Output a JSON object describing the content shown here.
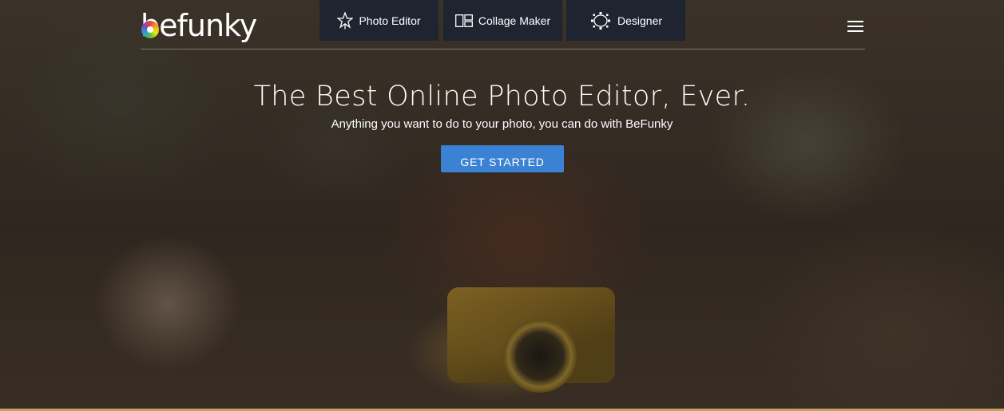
{
  "nav": {
    "logo_text": "befunky",
    "tabs": [
      {
        "label": "Photo Editor",
        "icon": "star-icon"
      },
      {
        "label": "Collage Maker",
        "icon": "collage-grid-icon"
      },
      {
        "label": "Designer",
        "icon": "designer-icon"
      }
    ],
    "menu_icon": "hamburger-menu-icon"
  },
  "hero": {
    "title": "The Best Online Photo Editor, Ever.",
    "subtitle": "Anything you want to do to your photo, you can do with BeFunky",
    "cta_label": "GET STARTED"
  },
  "colors": {
    "tab_background": "#1e2430",
    "cta_background": "#3b82d4",
    "text": "#ffffff"
  }
}
